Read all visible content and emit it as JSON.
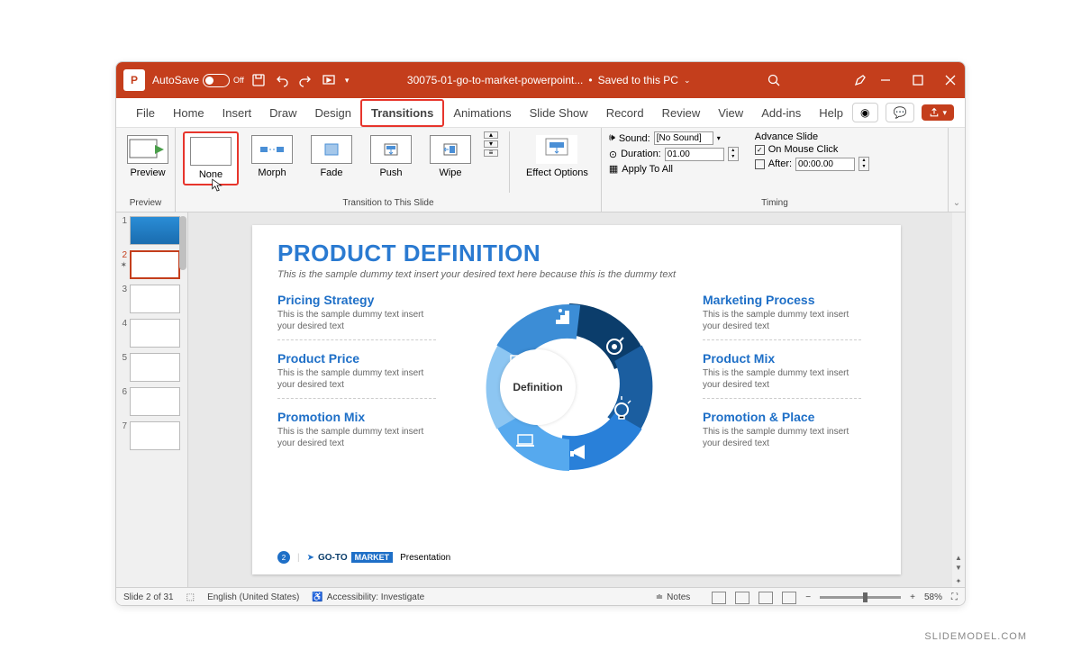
{
  "titlebar": {
    "autosave_label": "AutoSave",
    "autosave_state": "Off",
    "filename": "30075-01-go-to-market-powerpoint...",
    "save_status": "Saved to this PC"
  },
  "menubar": {
    "tabs": [
      "File",
      "Home",
      "Insert",
      "Draw",
      "Design",
      "Transitions",
      "Animations",
      "Slide Show",
      "Record",
      "Review",
      "View",
      "Add-ins",
      "Help"
    ],
    "active_tab": "Transitions"
  },
  "ribbon": {
    "preview": {
      "label": "Preview",
      "group_label": "Preview"
    },
    "transitions_group_label": "Transition to This Slide",
    "transitions": [
      {
        "label": "None",
        "selected": true
      },
      {
        "label": "Morph"
      },
      {
        "label": "Fade"
      },
      {
        "label": "Push"
      },
      {
        "label": "Wipe"
      }
    ],
    "effect_options": "Effect Options",
    "timing_group_label": "Timing",
    "sound_label": "Sound:",
    "sound_value": "[No Sound]",
    "duration_label": "Duration:",
    "duration_value": "01.00",
    "apply_all": "Apply To All",
    "advance_title": "Advance Slide",
    "on_mouse_click": "On Mouse Click",
    "on_mouse_click_checked": true,
    "after_label": "After:",
    "after_value": "00:00.00",
    "after_checked": false
  },
  "thumbnails": {
    "count_shown": 7,
    "active_index": 2
  },
  "slide": {
    "title": "PRODUCT DEFINITION",
    "subtitle": "This is the sample dummy text insert your desired text here because this is the dummy text",
    "center_label": "Definition",
    "left": [
      {
        "title": "Pricing Strategy",
        "body": "This is the sample dummy text insert your desired text"
      },
      {
        "title": "Product Price",
        "body": "This is the sample dummy text insert your desired text"
      },
      {
        "title": "Promotion Mix",
        "body": "This is the sample dummy text insert your desired text"
      }
    ],
    "right": [
      {
        "title": "Marketing Process",
        "body": "This is the sample dummy text insert your desired text"
      },
      {
        "title": "Product Mix",
        "body": "This is the sample dummy text insert your desired text"
      },
      {
        "title": "Promotion & Place",
        "body": "This is the sample dummy text insert your desired text"
      }
    ],
    "footer": {
      "page_num": "2",
      "brand1": "GO-TO",
      "brand2": "MARKET",
      "text": "Presentation"
    }
  },
  "statusbar": {
    "slide_info": "Slide 2 of 31",
    "language": "English (United States)",
    "accessibility": "Accessibility: Investigate",
    "notes_label": "Notes",
    "zoom_value": "58%"
  },
  "watermark": "SLIDEMODEL.COM"
}
